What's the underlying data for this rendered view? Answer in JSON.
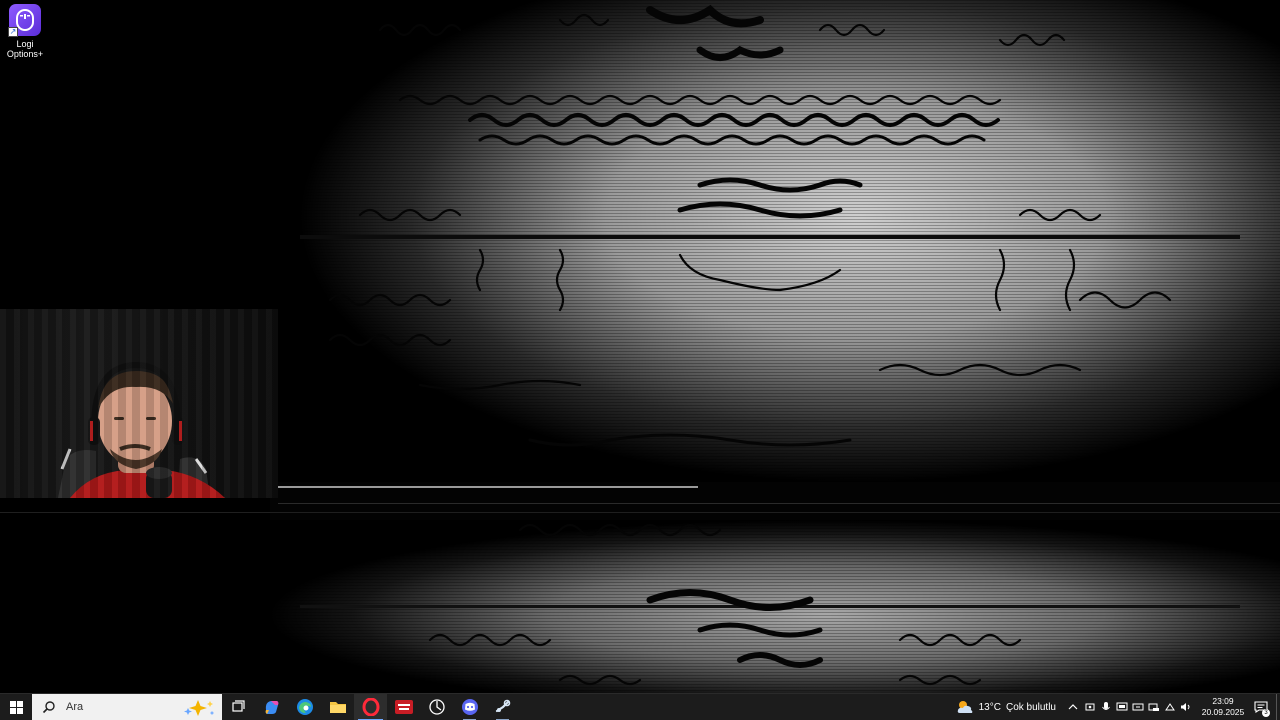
{
  "desktop": {
    "icons": [
      {
        "label": "Logi\nOptions+",
        "icon": "logi-options-icon"
      }
    ]
  },
  "webcam": {
    "visible": true
  },
  "taskbar": {
    "search": {
      "placeholder": "Ara"
    },
    "pinned": [
      {
        "name": "task-view-icon"
      },
      {
        "name": "copilot-icon"
      },
      {
        "name": "edge-icon"
      },
      {
        "name": "file-explorer-icon"
      },
      {
        "name": "opera-gx-icon"
      },
      {
        "name": "video-editor-icon"
      },
      {
        "name": "chatgpt-icon"
      },
      {
        "name": "discord-icon"
      },
      {
        "name": "steam-icon"
      }
    ],
    "weather": {
      "temp": "13°C",
      "condition": "Çok bulutlu",
      "icon": "cloudy-sun-icon"
    },
    "clock": {
      "time": "23:09",
      "date": "20.09.2025"
    },
    "notifications": {
      "count": "3"
    }
  }
}
